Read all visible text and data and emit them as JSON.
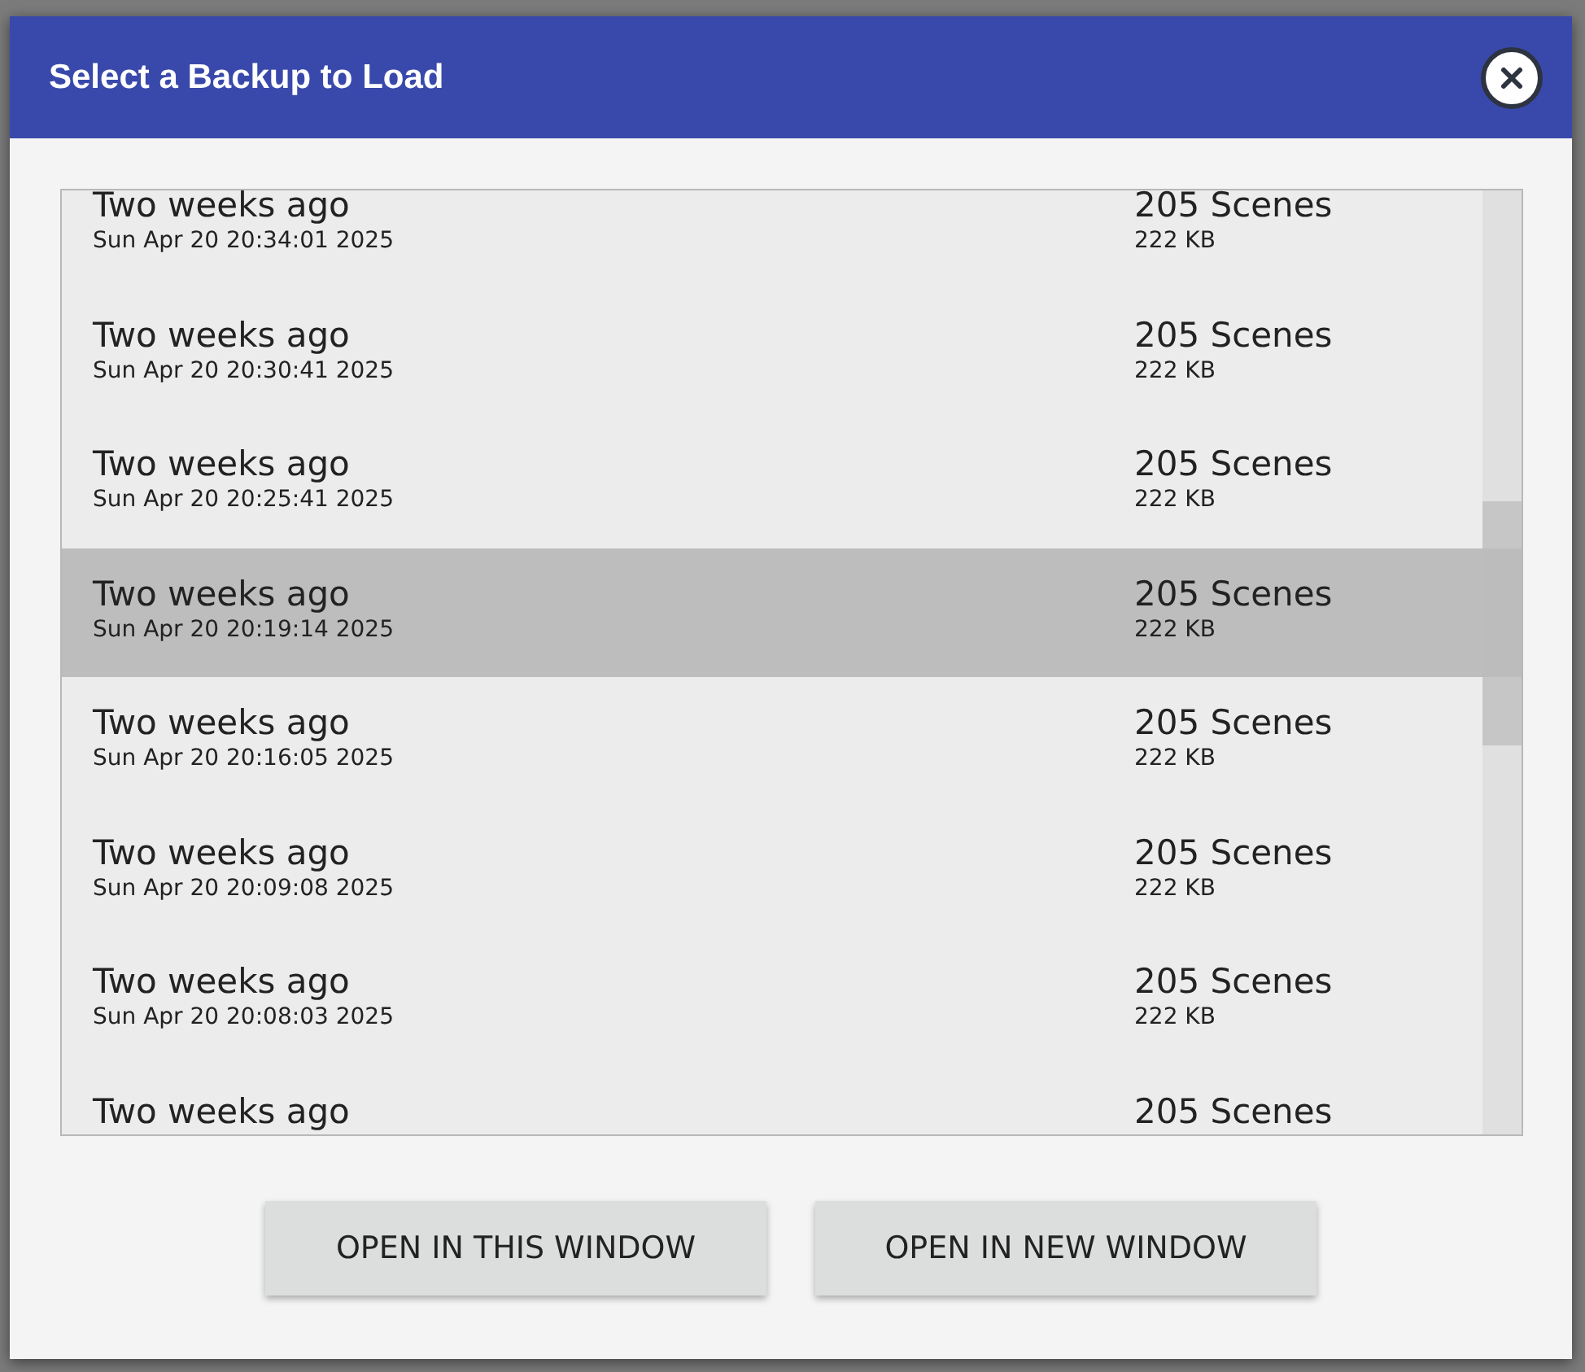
{
  "dialog": {
    "title": "Select a Backup to Load",
    "backups": [
      {
        "age": "Two weeks ago",
        "date": "Sun Apr 20 20:34:01 2025",
        "scenes": "205 Scenes",
        "size": "222 KB",
        "selected": false
      },
      {
        "age": "Two weeks ago",
        "date": "Sun Apr 20 20:30:41 2025",
        "scenes": "205 Scenes",
        "size": "222 KB",
        "selected": false
      },
      {
        "age": "Two weeks ago",
        "date": "Sun Apr 20 20:25:41 2025",
        "scenes": "205 Scenes",
        "size": "222 KB",
        "selected": false
      },
      {
        "age": "Two weeks ago",
        "date": "Sun Apr 20 20:19:14 2025",
        "scenes": "205 Scenes",
        "size": "222 KB",
        "selected": true
      },
      {
        "age": "Two weeks ago",
        "date": "Sun Apr 20 20:16:05 2025",
        "scenes": "205 Scenes",
        "size": "222 KB",
        "selected": false
      },
      {
        "age": "Two weeks ago",
        "date": "Sun Apr 20 20:09:08 2025",
        "scenes": "205 Scenes",
        "size": "222 KB",
        "selected": false
      },
      {
        "age": "Two weeks ago",
        "date": "Sun Apr 20 20:08:03 2025",
        "scenes": "205 Scenes",
        "size": "222 KB",
        "selected": false
      },
      {
        "age": "Two weeks ago",
        "scenes": "205 Scenes",
        "selected": false
      }
    ],
    "buttons": [
      "OPEN IN THIS WINDOW",
      "OPEN IN NEW WINDOW"
    ]
  }
}
